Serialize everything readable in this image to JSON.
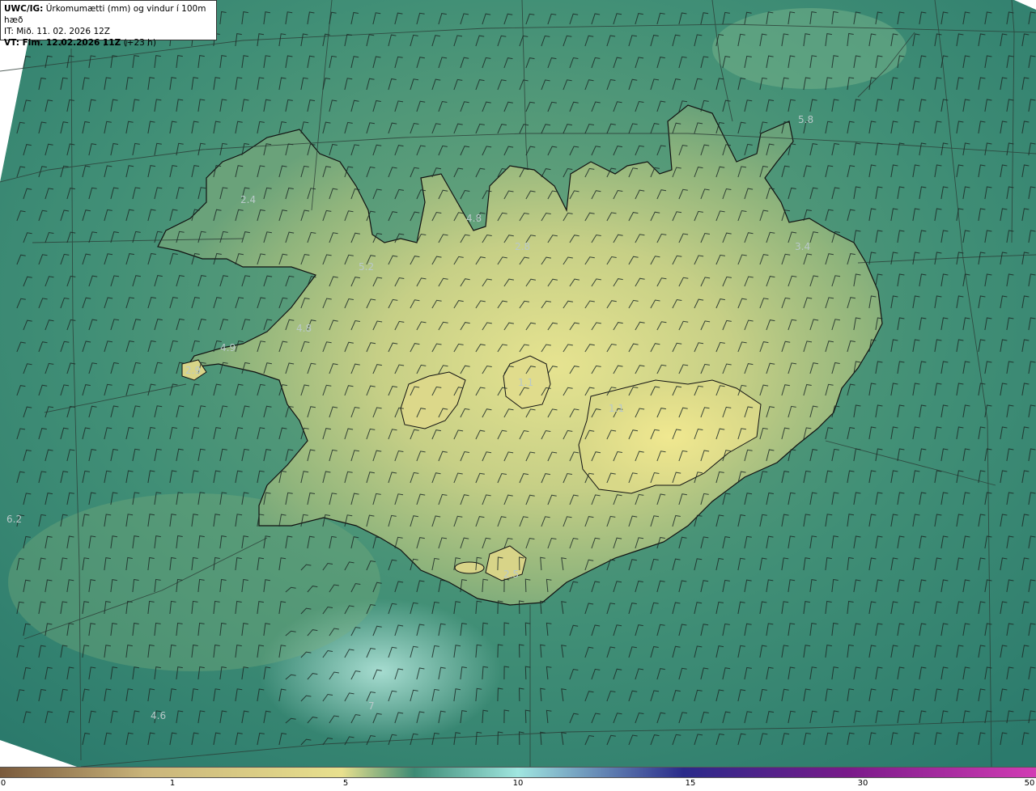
{
  "info": {
    "line1_bold": "UWC/IG:",
    "line1_rest": " Úrkomumætti (mm) og vindur í 100m hæð",
    "line2": "IT: Mið. 11. 02. 2026 12Z",
    "line3_bold": "VT: Fim. 12.02.2026 11Z",
    "line3_rest": " (+23 h)"
  },
  "value_labels": [
    {
      "id": "v1",
      "text": "5.8"
    },
    {
      "id": "v2",
      "text": "4.8"
    },
    {
      "id": "v3",
      "text": "2.4"
    },
    {
      "id": "v4",
      "text": "5.2"
    },
    {
      "id": "v5",
      "text": "4.8"
    },
    {
      "id": "v6",
      "text": "4.9"
    },
    {
      "id": "v7",
      "text": "2.9"
    },
    {
      "id": "v8",
      "text": "2.8"
    },
    {
      "id": "v9",
      "text": "1.1"
    },
    {
      "id": "v10",
      "text": "2.5"
    },
    {
      "id": "v11",
      "text": "6.2"
    },
    {
      "id": "v12",
      "text": "4.6"
    },
    {
      "id": "v13",
      "text": "7"
    },
    {
      "id": "v14",
      "text": "1.1"
    },
    {
      "id": "v15",
      "text": "3.4"
    }
  ],
  "colorbar": {
    "ticks": [
      "0",
      "1",
      "5",
      "10",
      "15",
      "30",
      "50"
    ],
    "colors": [
      "#7a5a3c",
      "#c9b47a",
      "#e8e08e",
      "#3c8a74",
      "#a0e6e0",
      "#2a2a8a",
      "#7a1a8a",
      "#d23cb4"
    ]
  },
  "colors": {
    "land_light": "#d8d88a",
    "land_mid": "#9fb878",
    "sea_mid": "#3f8f74",
    "sea_deep": "#2a7a6a",
    "coast": "#111111"
  }
}
